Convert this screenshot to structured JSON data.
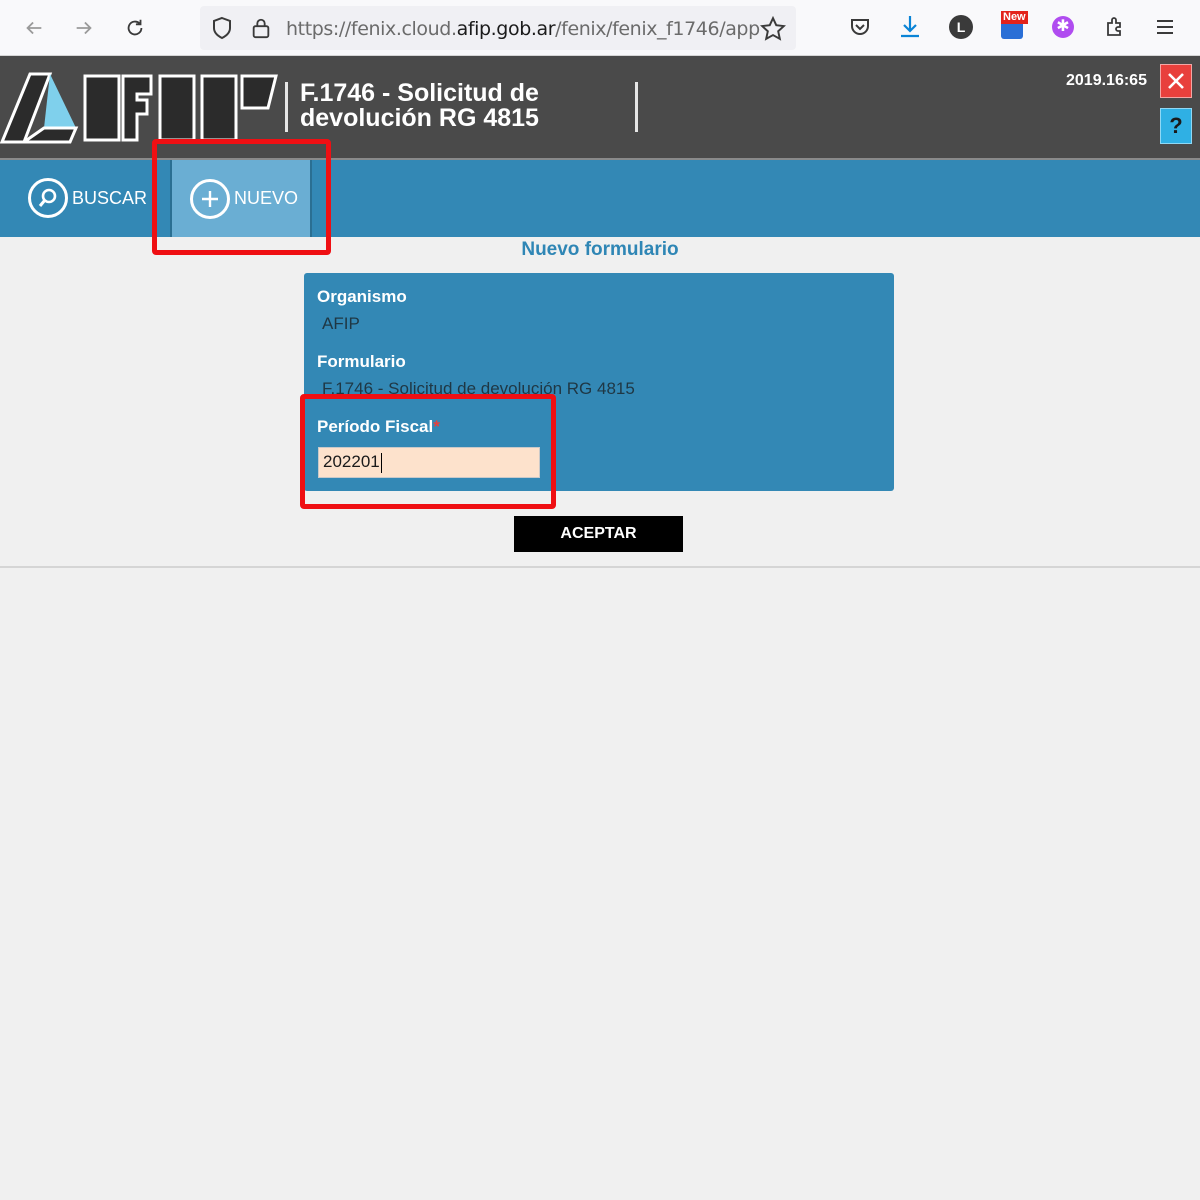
{
  "browser": {
    "url_prefix": "https://fenix.cloud.",
    "url_domain": "afip.gob.ar",
    "url_path": "/fenix/fenix_f1746/app",
    "extension_badge": "New",
    "profile_letter": "L"
  },
  "header": {
    "title_line1": "F.1746 - Solicitud de",
    "title_line2": "devolución RG 4815",
    "version": "2019.16:65",
    "help_label": "?"
  },
  "nav": {
    "buscar_label": "BUSCAR",
    "nuevo_label": "NUEVO"
  },
  "form": {
    "heading": "Nuevo formulario",
    "organismo_label": "Organismo",
    "organismo_value": "AFIP",
    "formulario_label": "Formulario",
    "formulario_value": "F.1746 - Solicitud de devolución RG 4815",
    "periodo_label": "Período Fiscal",
    "required_mark": "*",
    "periodo_value": "202201",
    "submit_label": "ACEPTAR"
  },
  "colors": {
    "header_bg": "#4a4a4a",
    "nav_bg": "#3388b5",
    "nav_active": "#6aaed3",
    "highlight": "#ef0f13",
    "input_bg": "#fde2cc"
  }
}
